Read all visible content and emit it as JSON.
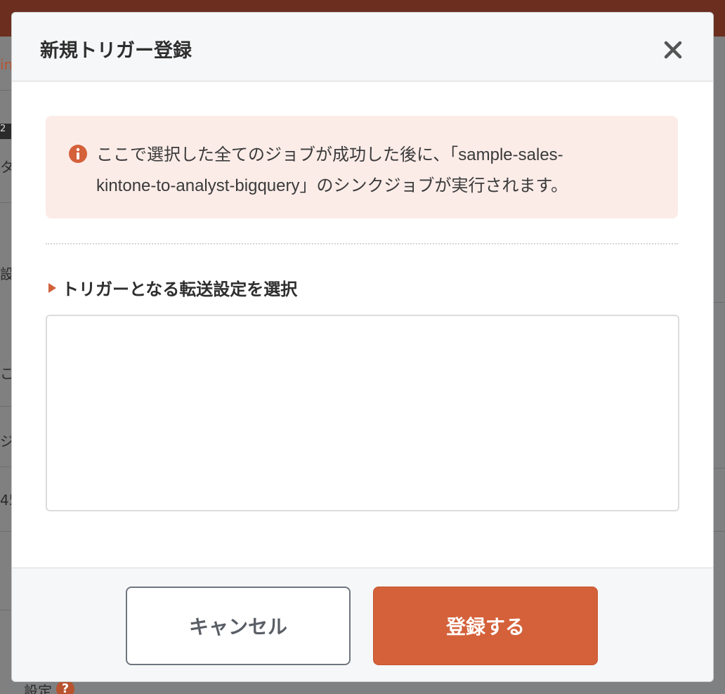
{
  "background": {
    "fragments": [
      "in",
      "2",
      "タ",
      "設",
      "こ",
      "ジ",
      "45"
    ],
    "bottom_label": "設定"
  },
  "modal": {
    "title": "新規トリガー登録",
    "alert": {
      "line1": "ここで選択した全てのジョブが成功した後に、「sample-sales-",
      "line2": "kintone-to-analyst-bigquery」のシンクジョブが実行されます。"
    },
    "section_heading": "トリガーとなる転送設定を選択",
    "cancel_label": "キャンセル",
    "submit_label": "登録する"
  },
  "colors": {
    "accent": "#d4613a",
    "alert_background": "#fbece8",
    "overlay": "#7f8081"
  },
  "icons": {
    "close": "close-icon",
    "alert": "info-icon"
  }
}
